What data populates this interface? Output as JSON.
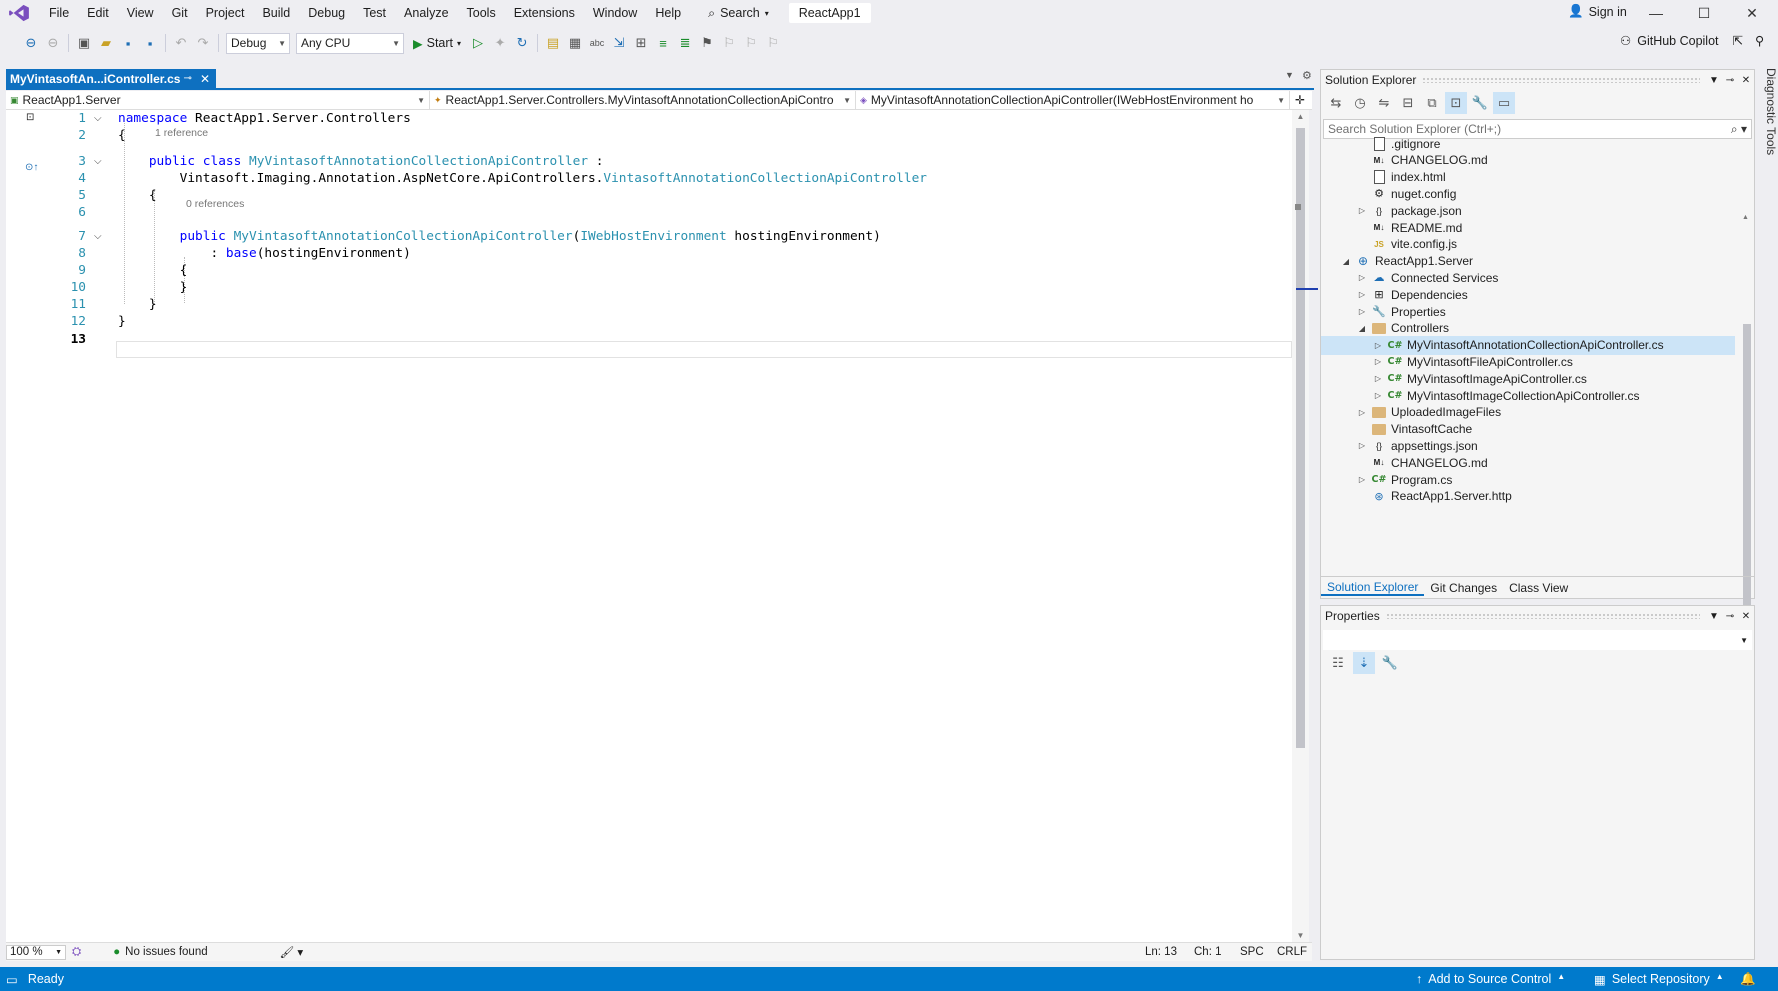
{
  "menu": {
    "items": [
      "File",
      "Edit",
      "View",
      "Git",
      "Project",
      "Build",
      "Debug",
      "Test",
      "Analyze",
      "Tools",
      "Extensions",
      "Window",
      "Help"
    ],
    "search_label": "Search",
    "solution_name": "ReactApp1",
    "sign_in": "Sign in"
  },
  "toolbar": {
    "configuration": "Debug",
    "platform": "Any CPU",
    "start_label": "Start",
    "copilot_label": "GitHub Copilot"
  },
  "editor": {
    "tab_title": "MyVintasoftAn...iController.cs",
    "nav": {
      "project": "ReactApp1.Server",
      "class": "ReactApp1.Server.Controllers.MyVintasoftAnnotationCollectionApiContro",
      "member": "MyVintasoftAnnotationCollectionApiController(IWebHostEnvironment ho"
    },
    "lines": [
      {
        "n": "1",
        "parts": [
          {
            "t": "namespace",
            "c": "kw"
          },
          {
            "t": " ReactApp1.Server.Controllers",
            "c": "pl"
          }
        ]
      },
      {
        "n": "2",
        "parts": [
          {
            "t": "{",
            "c": "pl"
          }
        ]
      },
      {
        "n": "3",
        "parts": [
          {
            "t": "    ",
            "c": "pl"
          },
          {
            "t": "public",
            "c": "kw"
          },
          {
            "t": " ",
            "c": "pl"
          },
          {
            "t": "class",
            "c": "kw"
          },
          {
            "t": " ",
            "c": "pl"
          },
          {
            "t": "MyVintasoftAnnotationCollectionApiController",
            "c": "ty"
          },
          {
            "t": " :",
            "c": "pl"
          }
        ]
      },
      {
        "n": "4",
        "parts": [
          {
            "t": "        Vintasoft.Imaging.Annotation.AspNetCore.ApiControllers.",
            "c": "pl"
          },
          {
            "t": "VintasoftAnnotationCollectionApiController",
            "c": "ty"
          }
        ]
      },
      {
        "n": "5",
        "parts": [
          {
            "t": "    {",
            "c": "pl"
          }
        ]
      },
      {
        "n": "6",
        "parts": []
      },
      {
        "n": "7",
        "parts": [
          {
            "t": "        ",
            "c": "pl"
          },
          {
            "t": "public",
            "c": "kw"
          },
          {
            "t": " ",
            "c": "pl"
          },
          {
            "t": "MyVintasoftAnnotationCollectionApiController",
            "c": "ty"
          },
          {
            "t": "(",
            "c": "pl"
          },
          {
            "t": "IWebHostEnvironment",
            "c": "ty"
          },
          {
            "t": " hostingEnvironment)",
            "c": "pl"
          }
        ]
      },
      {
        "n": "8",
        "parts": [
          {
            "t": "            : ",
            "c": "pl"
          },
          {
            "t": "base",
            "c": "kw"
          },
          {
            "t": "(hostingEnvironment)",
            "c": "pl"
          }
        ]
      },
      {
        "n": "9",
        "parts": [
          {
            "t": "        {",
            "c": "pl"
          }
        ]
      },
      {
        "n": "10",
        "parts": [
          {
            "t": "        }",
            "c": "pl"
          }
        ]
      },
      {
        "n": "11",
        "parts": [
          {
            "t": "    }",
            "c": "pl"
          }
        ]
      },
      {
        "n": "12",
        "parts": [
          {
            "t": "}",
            "c": "pl"
          }
        ]
      },
      {
        "n": "13",
        "parts": []
      }
    ],
    "codelens": {
      "class_refs": "1 reference",
      "ctor_refs": "0 references"
    },
    "status": {
      "zoom": "100 %",
      "issues": "No issues found",
      "ln": "Ln: 13",
      "ch": "Ch: 1",
      "spc": "SPC",
      "crlf": "CRLF"
    }
  },
  "solution_explorer": {
    "title": "Solution Explorer",
    "search_placeholder": "Search Solution Explorer (Ctrl+;)",
    "items": [
      {
        "label": ".gitignore",
        "icon": "file-icon",
        "expand": ""
      },
      {
        "label": "CHANGELOG.md",
        "icon": "markdown-icon",
        "expand": ""
      },
      {
        "label": "index.html",
        "icon": "html-icon",
        "expand": ""
      },
      {
        "label": "nuget.config",
        "icon": "config-icon",
        "expand": ""
      },
      {
        "label": "package.json",
        "icon": "json-icon",
        "expand": "▷"
      },
      {
        "label": "README.md",
        "icon": "markdown-icon",
        "expand": ""
      },
      {
        "label": "vite.config.js",
        "icon": "js-icon",
        "expand": ""
      },
      {
        "label": "ReactApp1.Server",
        "icon": "web-project-icon",
        "expand": "◢"
      },
      {
        "label": "Connected Services",
        "icon": "connected-services-icon",
        "expand": "▷"
      },
      {
        "label": "Dependencies",
        "icon": "dependencies-icon",
        "expand": "▷"
      },
      {
        "label": "Properties",
        "icon": "properties-folder-icon",
        "expand": "▷"
      },
      {
        "label": "Controllers",
        "icon": "folder-icon",
        "expand": "◢"
      },
      {
        "label": "MyVintasoftAnnotationCollectionApiController.cs",
        "icon": "csharp-icon",
        "expand": "▷"
      },
      {
        "label": "MyVintasoftFileApiController.cs",
        "icon": "csharp-icon",
        "expand": "▷"
      },
      {
        "label": "MyVintasoftImageApiController.cs",
        "icon": "csharp-icon",
        "expand": "▷"
      },
      {
        "label": "MyVintasoftImageCollectionApiController.cs",
        "icon": "csharp-icon",
        "expand": "▷"
      },
      {
        "label": "UploadedImageFiles",
        "icon": "folder-icon",
        "expand": "▷"
      },
      {
        "label": "VintasoftCache",
        "icon": "folder-icon",
        "expand": ""
      },
      {
        "label": "appsettings.json",
        "icon": "json-icon",
        "expand": "▷"
      },
      {
        "label": "CHANGELOG.md",
        "icon": "markdown-icon",
        "expand": ""
      },
      {
        "label": "Program.cs",
        "icon": "csharp-icon",
        "expand": "▷"
      },
      {
        "label": "ReactApp1.Server.http",
        "icon": "http-icon",
        "expand": ""
      }
    ],
    "tabs": [
      "Solution Explorer",
      "Git Changes",
      "Class View"
    ]
  },
  "properties": {
    "title": "Properties"
  },
  "side_tab": "Diagnostic Tools",
  "statusbar": {
    "ready": "Ready",
    "add_source": "Add to Source Control",
    "select_repo": "Select Repository"
  },
  "colors": {
    "accent": "#007acc",
    "tab_active": "#0e70c0",
    "keyword": "#0000ff",
    "type": "#2b91af"
  }
}
